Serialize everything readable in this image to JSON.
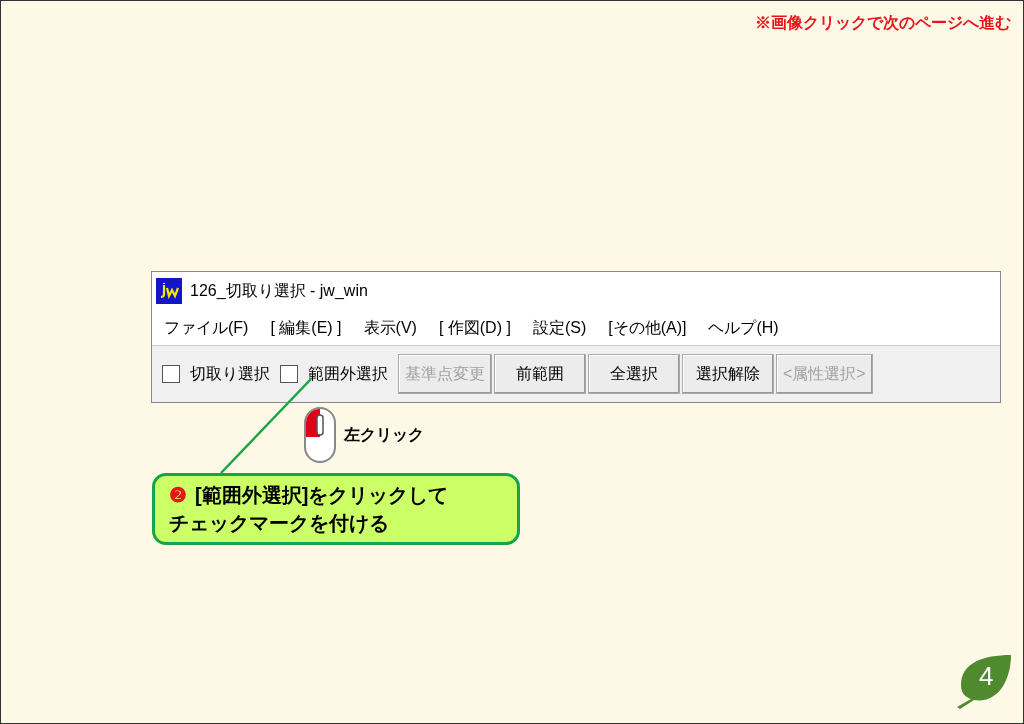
{
  "notice": "※画像クリックで次のページへ進む",
  "window": {
    "title": "126_切取り選択 - jw_win",
    "menu": [
      "ファイル(F)",
      "[ 編集(E) ]",
      "表示(V)",
      "[ 作図(D) ]",
      "設定(S)",
      "[その他(A)]",
      "ヘルプ(H)"
    ],
    "toolbar": [
      {
        "kind": "checkbox",
        "label": "切取り選択",
        "checked": false
      },
      {
        "kind": "checkbox",
        "label": "範囲外選択",
        "checked": false
      },
      {
        "kind": "button",
        "label": "基準点変更",
        "disabled": true
      },
      {
        "kind": "button",
        "label": "前範囲",
        "disabled": false
      },
      {
        "kind": "button",
        "label": "全選択",
        "disabled": false
      },
      {
        "kind": "button",
        "label": "選択解除",
        "disabled": false
      },
      {
        "kind": "button",
        "label": "<属性選択>",
        "disabled": true
      }
    ]
  },
  "mouse_label": "左クリック",
  "callout": {
    "marker": "❷",
    "lines": [
      "[範囲外選択]をクリックして",
      "チェックマークを付ける"
    ]
  },
  "page_number": "4"
}
